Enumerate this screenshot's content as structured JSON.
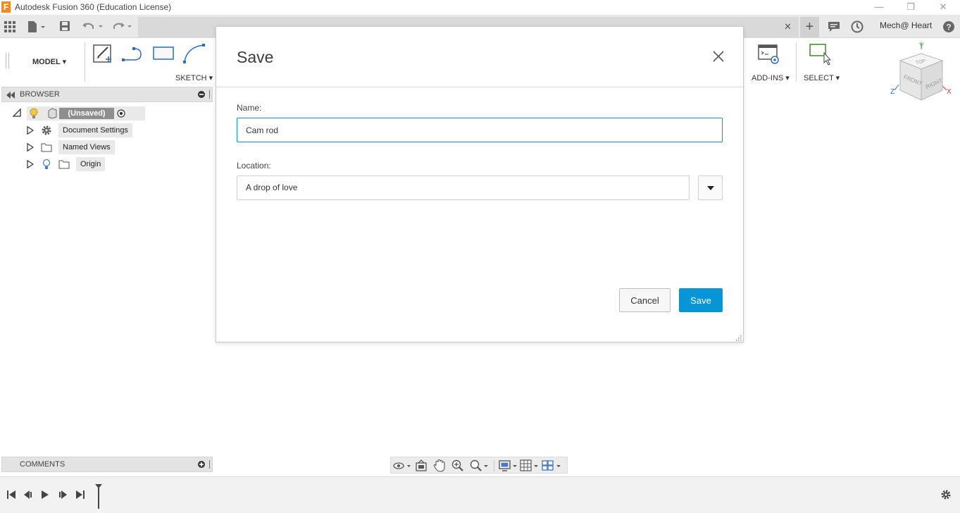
{
  "window": {
    "title": "Autodesk Fusion 360 (Education License)",
    "logo_letter": "F",
    "min_glyph": "—",
    "restore_glyph": "❐",
    "close_glyph": "✕"
  },
  "appbar": {
    "user_name": "Mech@ Heart",
    "new_tab_glyph": "+",
    "doc_tab_close_glyph": "✕"
  },
  "toolbar": {
    "workspace": "MODEL ▾",
    "sketch_label": "SKETCH ▾",
    "addins_label": "ADD-INS ▾",
    "select_label": "SELECT ▾"
  },
  "browser": {
    "title": "BROWSER",
    "root_label": "(Unsaved)",
    "items": [
      {
        "label": "Document Settings",
        "icon": "gear-icon"
      },
      {
        "label": "Named Views",
        "icon": "folder-icon"
      },
      {
        "label": "Origin",
        "icon": "folder-icon"
      }
    ]
  },
  "comments": {
    "title": "COMMENTS"
  },
  "viewcube": {
    "top": "TOP",
    "front": "FRONT",
    "right": "RIGHT",
    "axis_x": "X",
    "axis_y": "Y",
    "axis_z": "Z"
  },
  "dialog": {
    "title": "Save",
    "name_label": "Name:",
    "name_value": "Cam rod",
    "location_label": "Location:",
    "location_value": "A drop of love",
    "cancel_label": "Cancel",
    "save_label": "Save"
  },
  "colors": {
    "accent": "#0696d7",
    "logo": "#f08a24"
  }
}
